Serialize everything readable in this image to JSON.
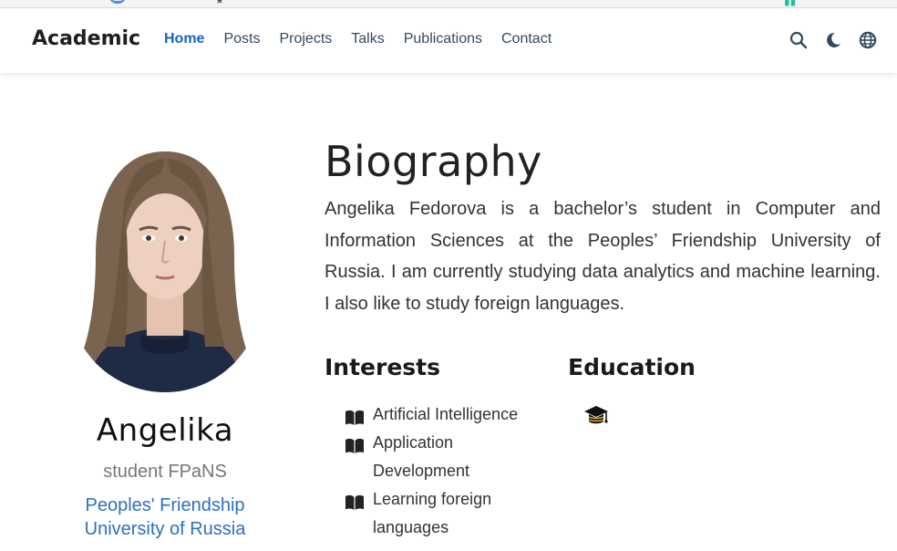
{
  "nav": {
    "brand": "Academic",
    "links": [
      {
        "label": "Home",
        "active": true
      },
      {
        "label": "Posts",
        "active": false
      },
      {
        "label": "Projects",
        "active": false
      },
      {
        "label": "Talks",
        "active": false
      },
      {
        "label": "Publications",
        "active": false
      },
      {
        "label": "Contact",
        "active": false
      }
    ],
    "icons": [
      "search-icon",
      "moon-icon",
      "globe-icon"
    ]
  },
  "profile": {
    "name": "Angelika",
    "role": "student FPaNS",
    "organization_line1": "Peoples' Friendship",
    "organization_line2": "University of Russia"
  },
  "biography": {
    "title": "Biography",
    "text": "Angelika Fedorova is a bachelor’s student in Computer and Information Sciences at the Peoples’ Friendship University of Russia. I am currently studying data analytics and machine learning. I also like to study foreign languages."
  },
  "interests": {
    "title": "Interests",
    "items": [
      "Artificial Intelligence",
      "Application Development",
      "Learning foreign languages"
    ]
  },
  "education": {
    "title": "Education",
    "icon": "graduation-cap-icon"
  },
  "colors": {
    "accent": "#1565c0",
    "link": "#2e6fbf",
    "muted": "#777777"
  }
}
